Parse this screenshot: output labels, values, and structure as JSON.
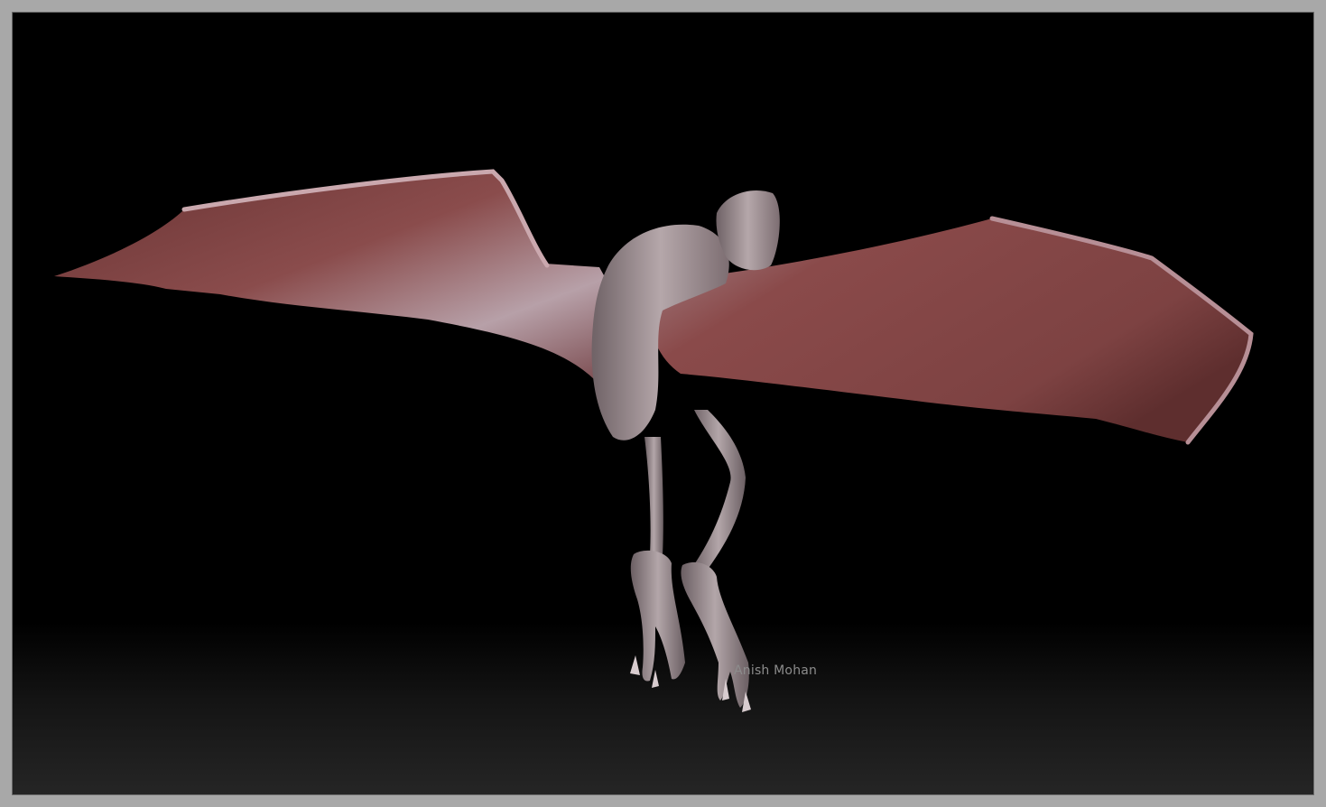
{
  "canvas": {
    "watermark": "Anish Mohan",
    "colors": {
      "frame": "#a8a8a8",
      "background_top": "#000000",
      "background_bottom": "#252525",
      "wing_membrane": "#7a3f3f",
      "skin_highlight": "#c8b6b8",
      "body": "#8e7c80"
    },
    "subject": "winged-creature-sculpt"
  }
}
